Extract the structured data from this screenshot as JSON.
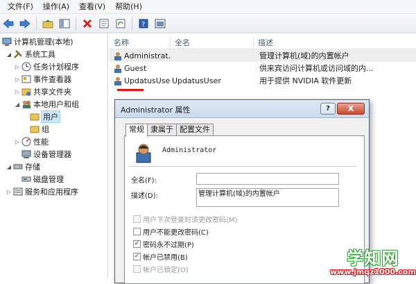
{
  "menu": [
    "文件(F)",
    "操作(A)",
    "查看(V)",
    "帮助(H)"
  ],
  "toolbar_icons": [
    "back-icon",
    "forward-icon",
    "up-folder-icon",
    "show-tree-icon",
    "delete-icon",
    "properties-icon",
    "refresh-icon",
    "export-icon",
    "help-icon",
    "console-icon"
  ],
  "tree": {
    "root": "计算机管理(本地)",
    "system_tools": "系统工具",
    "task_scheduler": "任务计划程序",
    "event_viewer": "事件查看器",
    "shared_folders": "共享文件夹",
    "local_users": "本地用户和组",
    "users": "用户",
    "groups": "组",
    "performance": "性能",
    "device_manager": "设备管理器",
    "storage": "存储",
    "disk_management": "磁盘管理",
    "services": "服务和应用程序"
  },
  "list": {
    "columns": [
      "名称",
      "全名",
      "描述"
    ],
    "rows": [
      {
        "name": "Administrat...",
        "full": "",
        "desc": "管理计算机(域)的内置帐户"
      },
      {
        "name": "Guest",
        "full": "",
        "desc": "供来宾访问计算机或访问域的内..."
      },
      {
        "name": "UpdatusUser",
        "full": "UpdatusUser",
        "desc": "用于提供 NVIDIA 软件更新"
      }
    ]
  },
  "dialog": {
    "title": "Administrator 属性",
    "help_label": "?",
    "close_label": "X",
    "tabs": [
      "常规",
      "隶属于",
      "配置文件"
    ],
    "username": "Administrator",
    "fullname_label": "全名(F):",
    "fullname_value": "",
    "desc_label": "描述(D):",
    "desc_value": "管理计算机(域)的内置帐户",
    "options": [
      {
        "label": "用户下次登录时须更改密码(M)",
        "checked": false,
        "disabled": true
      },
      {
        "label": "用户不能更改密码(C)",
        "checked": false,
        "disabled": false
      },
      {
        "label": "密码永不过期(P)",
        "checked": true,
        "disabled": false
      },
      {
        "label": "帐户已禁用(B)",
        "checked": true,
        "disabled": false
      },
      {
        "label": "帐户已锁定(O)",
        "checked": false,
        "disabled": true
      }
    ]
  },
  "watermark": {
    "title": "学知网",
    "url": "www.jmqz1000.com"
  },
  "colors": {
    "red_mark": "#e8150e",
    "selection": "#cce8ff"
  }
}
